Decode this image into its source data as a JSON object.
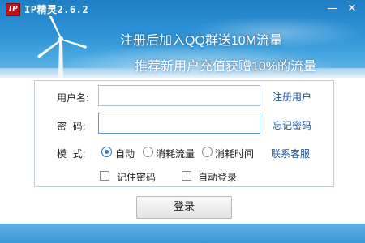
{
  "window": {
    "title": "IP精灵2.6.2",
    "logo_text": "IP",
    "minimize_icon": "minimize-icon",
    "close_icon": "close-icon"
  },
  "banner": {
    "promo_line_1": "注册后加入QQ群送10M流量",
    "promo_line_2": "推荐新用户充值获赠10%的流量"
  },
  "form": {
    "username_label": "用户名:",
    "username_value": "",
    "password_label": "密  码:",
    "password_value": "",
    "register_link": "注册用户",
    "forgot_link": "忘记密码",
    "mode_label": "模  式:",
    "mode_options": [
      "自动",
      "消耗流量",
      "消耗时间"
    ],
    "mode_selected": "自动",
    "contact_link": "联系客服",
    "remember_password": "记住密码",
    "auto_login": "自动登录",
    "remember_checked": false,
    "auto_login_checked": false
  },
  "actions": {
    "login_label": "登录"
  },
  "colors": {
    "banner_top": "#1f7fc6",
    "link": "#1d4f91",
    "logo_bg": "#c0121a",
    "radio_accent": "#2f76c6",
    "footer": "#3a97d7"
  }
}
